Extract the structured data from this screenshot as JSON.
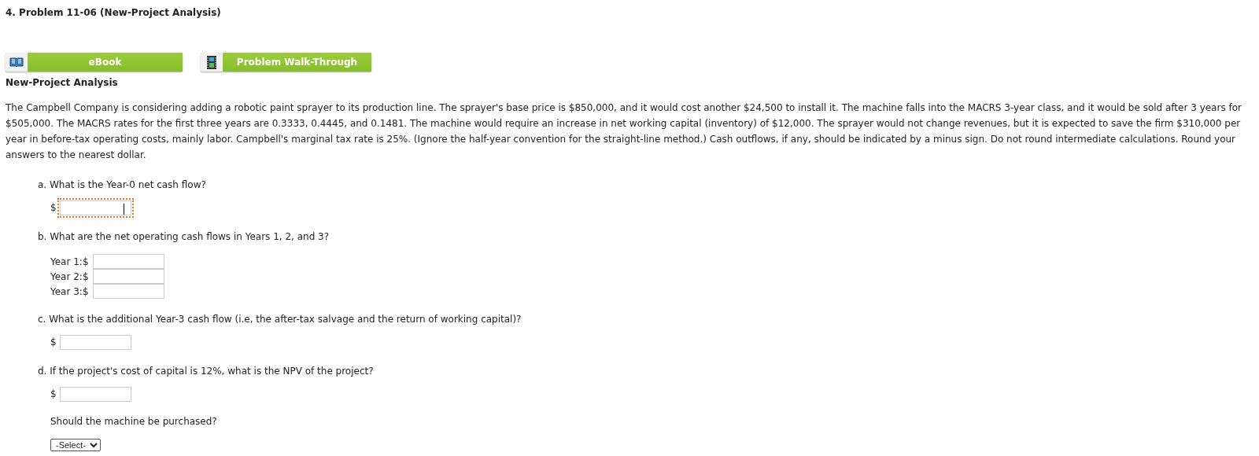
{
  "title": "4.  Problem 11-06 (New-Project Analysis)",
  "buttons": [
    {
      "label": "eBook",
      "kind": "book"
    },
    {
      "label": "Problem Walk-Through",
      "kind": "film"
    }
  ],
  "section_heading": "New-Project Analysis",
  "paragraph": "The Campbell Company is considering adding a robotic paint sprayer to its production line. The sprayer's base price is $850,000, and it would cost another $24,500 to install it. The machine falls into the MACRS 3-year class, and it would be sold after 3 years for $505,000. The MACRS rates for the first three years are 0.3333, 0.4445, and 0.1481. The machine would require an increase in net working capital (inventory) of $12,000. The sprayer would not change revenues, but it is expected to save the firm $310,000 per year in before-tax operating costs, mainly labor. Campbell's marginal tax rate is 25%. (Ignore the half-year convention for the straight-line method.) Cash outflows, if any, should be indicated by a minus sign. Do not round intermediate calculations. Round your answers to the nearest dollar.",
  "questions": [
    {
      "label": "a. What is the Year-0 net cash flow?",
      "kind": "single",
      "answers": [
        {
          "prefix": "$",
          "focused": true
        }
      ]
    },
    {
      "label": "b. What are the net operating cash flows in Years 1, 2, and 3?",
      "kind": "table",
      "answers": [
        {
          "prefix": "Year 1:$",
          "focused": false
        },
        {
          "prefix": "Year 2:$",
          "focused": false
        },
        {
          "prefix": "Year 3:$",
          "focused": false
        }
      ]
    },
    {
      "label": "c. What is the additional Year-3 cash flow (i.e, the after-tax salvage and the return of working capital)?",
      "kind": "single",
      "answers": [
        {
          "prefix": "$",
          "focused": false
        }
      ]
    },
    {
      "label": "d. If the project's cost of capital is 12%, what is the NPV of the project?",
      "kind": "single",
      "answers": [
        {
          "prefix": "$",
          "focused": false
        }
      ],
      "followup": {
        "text": "Should the machine be purchased?",
        "select": "-Select-"
      }
    }
  ]
}
